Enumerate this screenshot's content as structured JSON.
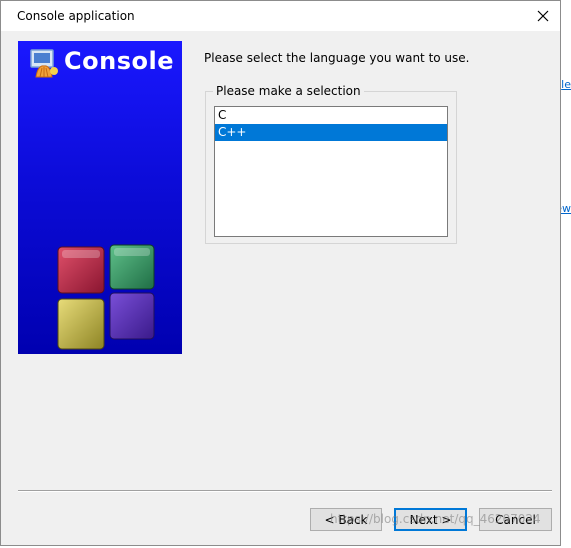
{
  "window": {
    "title": "Console application"
  },
  "banner": {
    "title": "Console"
  },
  "prompt": "Please select the language you want to use.",
  "selection": {
    "group_label": "Please make a selection",
    "options": [
      "C",
      "C++"
    ],
    "selected": "C++"
  },
  "buttons": {
    "back": "< Back",
    "next": "Next >",
    "cancel": "Cancel"
  },
  "background": {
    "link1": "le",
    "link2": "ew"
  },
  "watermark": "https://blog.csdn.net/qq_46207024",
  "colors": {
    "selection": "#0078d7",
    "banner": "#0c0cd8",
    "dialog_bg": "#f0f0f0"
  }
}
